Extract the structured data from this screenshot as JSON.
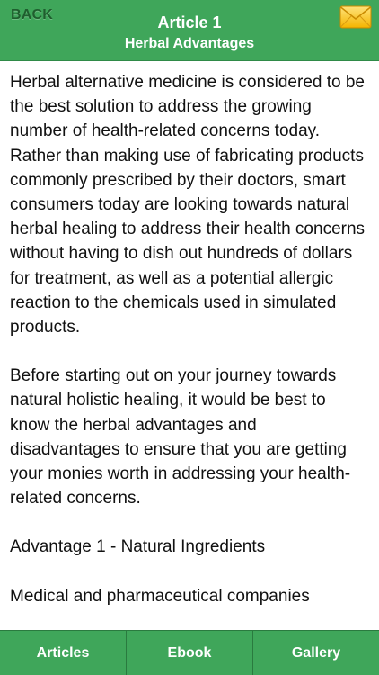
{
  "header": {
    "back_label": "BACK",
    "title": "Article 1",
    "subtitle": "Herbal Advantages",
    "mail_icon": "envelope-icon",
    "accent_color": "#3fa65a"
  },
  "article": {
    "paragraphs": [
      "Herbal alternative medicine is considered to be the best solution to address the growing number of health-related concerns today. Rather than making use of fabricating products commonly prescribed by their doctors, smart consumers today are looking towards natural herbal healing to address their health concerns without having to dish out hundreds of dollars for treatment, as well as a potential allergic reaction to the chemicals used in simulated products.",
      "Before starting out on your journey towards natural holistic healing, it would be best to know the herbal advantages and disadvantages to ensure that you are getting your monies worth in addressing your health-related concerns.",
      "Advantage 1 - Natural Ingredients",
      "Medical and pharmaceutical companies"
    ]
  },
  "tabs": [
    {
      "label": "Articles"
    },
    {
      "label": "Ebook"
    },
    {
      "label": "Gallery"
    }
  ]
}
